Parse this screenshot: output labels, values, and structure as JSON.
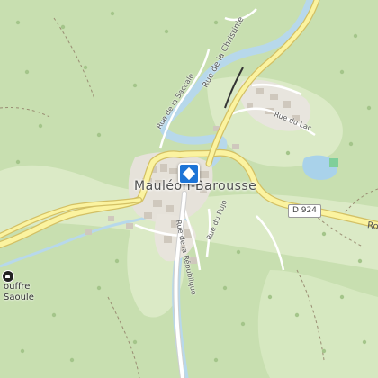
{
  "map": {
    "town_label": "Mauléon-Barousse",
    "streets": {
      "rue_de_la_christinie": "Rue de la Christinie",
      "rue_de_la_saccale": "Rue de la Saccale",
      "rue_du_lac": "Rue du Lac",
      "rue_du_pujo": "Rue du Pujo",
      "rue_de_la_republique": "Rue de la République"
    },
    "road_shield": "D 924",
    "road_label_edge": "Ro",
    "poi": {
      "line1": "ouffre",
      "line2": "Saoule",
      "icon": "cave-icon"
    },
    "marker_icon": "location-pin-icon",
    "colors": {
      "forest": "#c7deb0",
      "meadow": "#dcebc8",
      "road_fill": "#fbf2a0",
      "road_casing": "#d8c46a",
      "river": "#b6d8ea",
      "marker": "#1d74d6"
    }
  }
}
